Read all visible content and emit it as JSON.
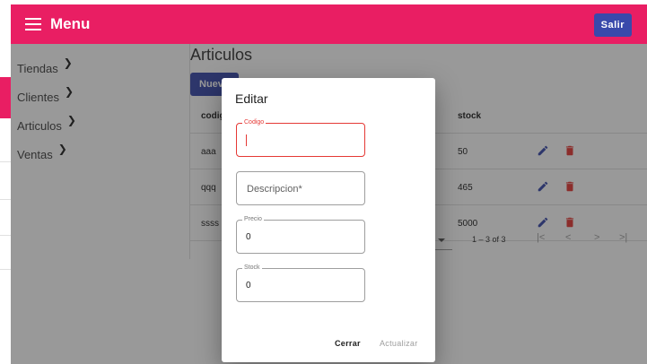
{
  "appbar": {
    "menu_label": "Menu",
    "logout_label": "Salir"
  },
  "sidebar": {
    "items": [
      {
        "label": "Tiendas"
      },
      {
        "label": "Clientes"
      },
      {
        "label": "Articulos"
      },
      {
        "label": "Ventas"
      }
    ]
  },
  "page": {
    "title": "Articulos",
    "new_label": "Nuevo"
  },
  "table": {
    "headers": [
      "codigo",
      "stock"
    ],
    "rows": [
      {
        "codigo": "aaa",
        "stock": "50"
      },
      {
        "codigo": "qqq",
        "stock": "465"
      },
      {
        "codigo": "ssss",
        "stock": "5000"
      }
    ],
    "page_info": "1 – 3 of 3"
  },
  "dialog": {
    "title": "Editar",
    "fields": {
      "codigo": {
        "label": "Codigo",
        "value": ""
      },
      "descripcion": {
        "placeholder": "Descripcion*"
      },
      "precio": {
        "label": "Precio",
        "value": "0"
      },
      "stock": {
        "label": "Stock",
        "value": "0"
      }
    },
    "close_label": "Cerrar",
    "update_label": "Actualizar"
  },
  "colors": {
    "primary": "#e91e63",
    "accent": "#3949ab",
    "warn": "#e53935"
  },
  "icons": {
    "menu": "menu-icon",
    "chevron": "chevron-right-icon",
    "edit": "pencil-icon",
    "delete": "trash-icon"
  }
}
